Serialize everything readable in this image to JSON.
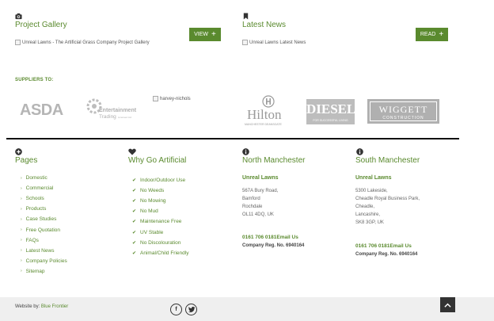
{
  "gallery": {
    "title": "Project Gallery",
    "image_alt": "Unreal Lawns - The Artificial Grass Company Project Gallery",
    "button_label": "VIEW"
  },
  "news": {
    "title": "Latest News",
    "image_alt": "Unreal Lawns Latest News",
    "button_label": "READ"
  },
  "suppliers": {
    "label": "SUPPLIERS TO:",
    "logos": {
      "asda": "ASDA",
      "entertainment_top": "Entertainment",
      "entertainment_bottom": "Trading",
      "entertainment_small": "Licensed Ltd",
      "harvey_alt": "harvey-nichols",
      "hilton": "Hilton",
      "hilton_sub": "MANCHESTER DEANSGATE",
      "diesel": "DIESEL",
      "diesel_sub": "FOR SUCCESSFUL LIVING",
      "wiggett": "WIGGETT",
      "wiggett_sub": "CONSTRUCTION"
    }
  },
  "pages": {
    "title": "Pages",
    "items": [
      "Domestic",
      "Commercial",
      "Schools",
      "Products",
      "Case Studies",
      "Free Quotation",
      "FAQs",
      "Latest News",
      "Company Policies",
      "Sitemap"
    ]
  },
  "why": {
    "title": "Why Go Artificial",
    "items": [
      "Indoor/Outdoor Use",
      "No Weeds",
      "No Mowing",
      "No Mud",
      "Maintenance Free",
      "UV Stable",
      "No Discolouration",
      "Animal/Child Friendly"
    ]
  },
  "north": {
    "title": "North Manchester",
    "name": "Unreal Lawns",
    "address": [
      "567A Bury Road,",
      "Bamford",
      "Rochdale",
      "OL11 4DQ, UK"
    ],
    "phone": "0161 706 0181",
    "email": "Email Us",
    "reg": "Company Reg. No. 6940164"
  },
  "south": {
    "title": "South Manchester",
    "name": "Unreal Lawns",
    "address": [
      "5300 Lakeside,",
      "Cheadle Royal Business Park,",
      "Cheadle,",
      "Lancashire,",
      "SK8 3GP, UK"
    ],
    "phone": "0161 706 0181",
    "email": "Email Us",
    "reg": "Company Reg. No. 6940164"
  },
  "footer": {
    "website_prefix": "Website by: ",
    "website_link": "Blue Frontier",
    "facebook": "f"
  },
  "colors": {
    "accent": "#5a8a2e",
    "bottom_bar": "#efefef"
  }
}
